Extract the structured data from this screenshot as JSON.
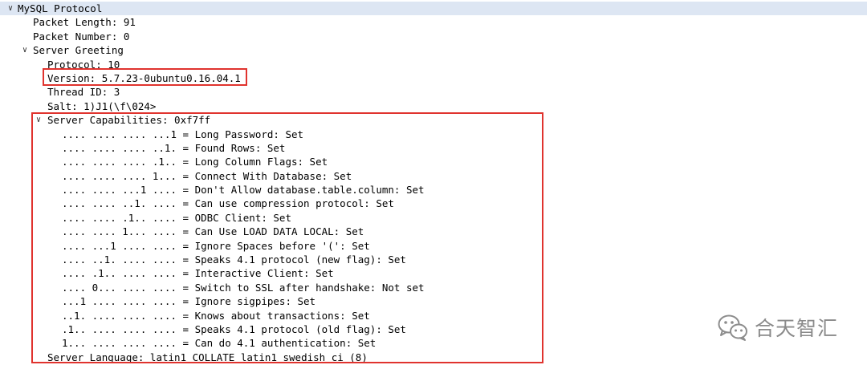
{
  "tree": {
    "root": {
      "label": "MySQL Protocol",
      "expanded": true
    },
    "packet_length": "Packet Length: 91",
    "packet_number": "Packet Number: 0",
    "server_greeting": {
      "label": "Server Greeting",
      "expanded": true
    },
    "protocol": "Protocol: 10",
    "version": "Version: 5.7.23-0ubuntu0.16.04.1",
    "thread_id": "Thread ID: 3",
    "salt": "Salt: 1)J1(\\f\\024>",
    "server_capabilities": {
      "label": "Server Capabilities: 0xf7ff",
      "expanded": true
    },
    "capabilities": [
      ".... .... .... ...1 = Long Password: Set",
      ".... .... .... ..1. = Found Rows: Set",
      ".... .... .... .1.. = Long Column Flags: Set",
      ".... .... .... 1... = Connect With Database: Set",
      ".... .... ...1 .... = Don't Allow database.table.column: Set",
      ".... .... ..1. .... = Can use compression protocol: Set",
      ".... .... .1.. .... = ODBC Client: Set",
      ".... .... 1... .... = Can Use LOAD DATA LOCAL: Set",
      ".... ...1 .... .... = Ignore Spaces before '(': Set",
      ".... ..1. .... .... = Speaks 4.1 protocol (new flag): Set",
      ".... .1.. .... .... = Interactive Client: Set",
      ".... 0... .... .... = Switch to SSL after handshake: Not set",
      "...1 .... .... .... = Ignore sigpipes: Set",
      "..1. .... .... .... = Knows about transactions: Set",
      ".1.. .... .... .... = Speaks 4.1 protocol (old flag): Set",
      "1... .... .... .... = Can do 4.1 authentication: Set"
    ],
    "server_language": "Server Language: latin1 COLLATE latin1 swedish ci (8)"
  },
  "watermark": {
    "text": "合天智汇",
    "icon": "wechat-icon"
  },
  "colors": {
    "highlight_border": "#e0332e",
    "selected_row": "#dde6f3",
    "watermark": "#8a8a8a"
  }
}
